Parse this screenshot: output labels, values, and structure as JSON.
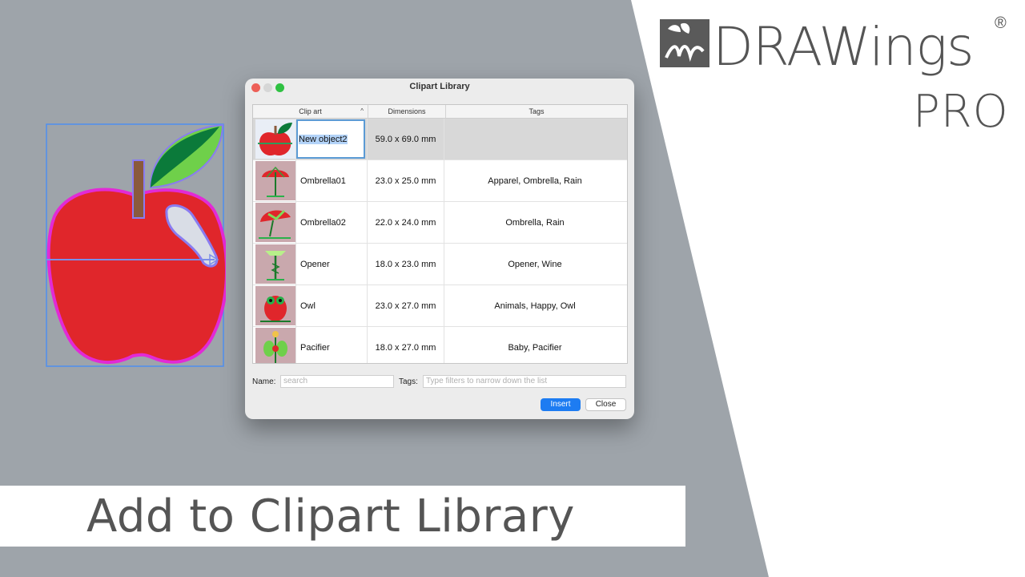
{
  "brand": {
    "name": "DRAWings",
    "registered": "®",
    "edition": "PRO"
  },
  "caption": "Add to Clipart Library",
  "dialog": {
    "title": "Clipart Library",
    "columns": [
      "Clip art",
      "Dimensions",
      "Tags"
    ],
    "rows": [
      {
        "name": "New object2",
        "dimensions": "59.0 x 69.0 mm",
        "tags": "",
        "selected": true
      },
      {
        "name": "Ombrella01",
        "dimensions": "23.0 x 25.0 mm",
        "tags": "Apparel, Ombrella, Rain"
      },
      {
        "name": "Ombrella02",
        "dimensions": "22.0 x 24.0 mm",
        "tags": "Ombrella, Rain"
      },
      {
        "name": "Opener",
        "dimensions": "18.0 x 23.0 mm",
        "tags": "Opener, Wine"
      },
      {
        "name": "Owl",
        "dimensions": "23.0 x 27.0 mm",
        "tags": "Animals, Happy, Owl"
      },
      {
        "name": "Pacifier",
        "dimensions": "18.0 x 27.0 mm",
        "tags": "Baby, Pacifier"
      }
    ],
    "name_label": "Name:",
    "name_placeholder": "search",
    "tags_label": "Tags:",
    "tags_placeholder": "Type filters to narrow down the list",
    "insert_label": "Insert",
    "close_label": "Close"
  },
  "colors": {
    "accent": "#1d7cf2",
    "apple_red": "#e0262b",
    "outline_magenta": "#e22ad6",
    "selection_blue": "#5b9bd5"
  },
  "icons": [
    "close-traffic-light",
    "minimize-traffic-light",
    "zoom-traffic-light",
    "sort-up-icon",
    "drawings-logo-icon"
  ]
}
